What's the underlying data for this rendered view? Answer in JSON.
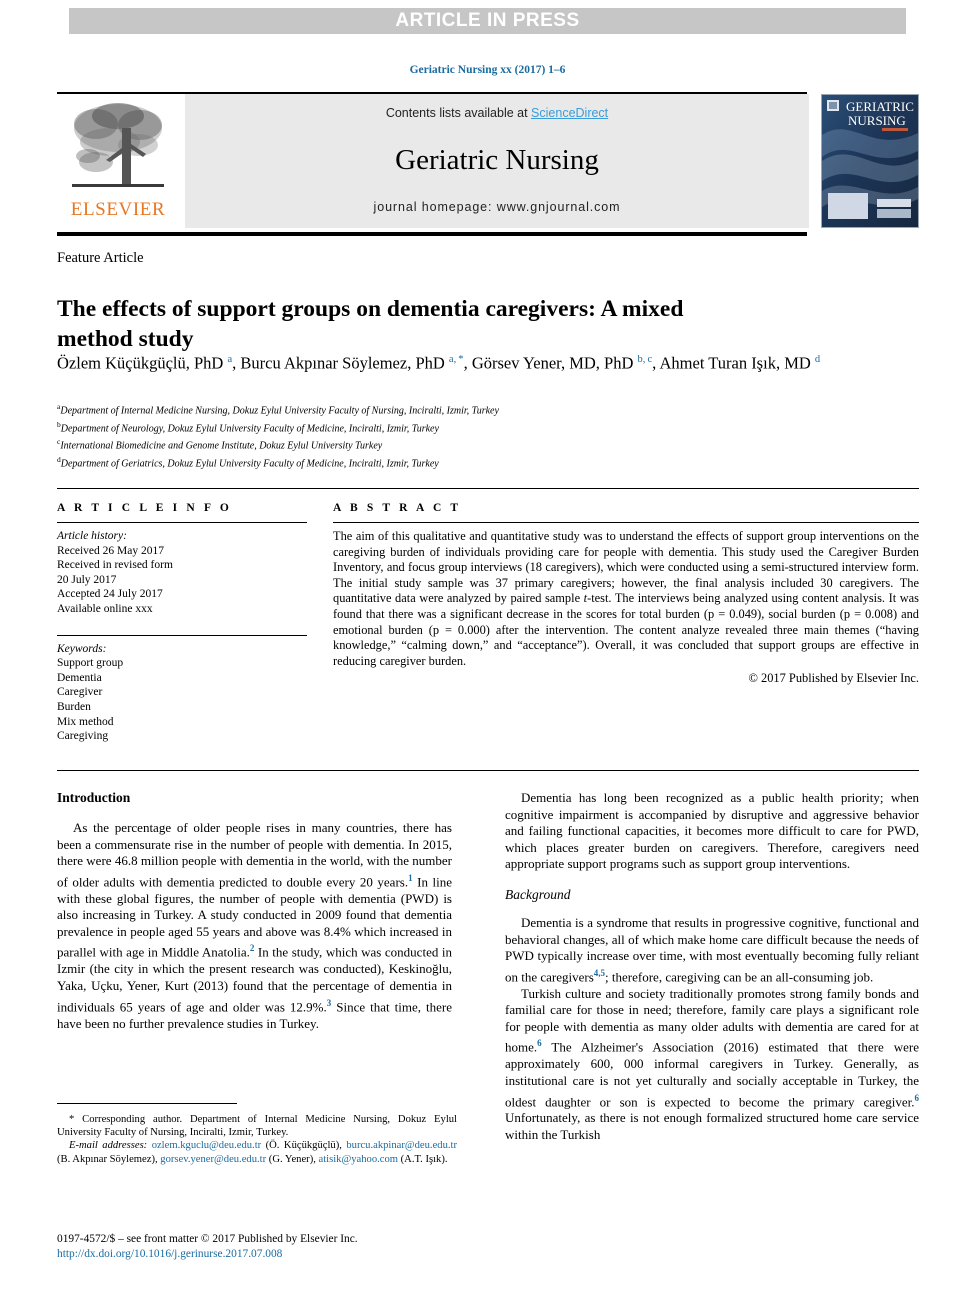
{
  "banner": {
    "text": "ARTICLE IN PRESS"
  },
  "running_head": "Geriatric Nursing xx (2017) 1–6",
  "masthead": {
    "contents_prefix": "Contents lists available at ",
    "sciencedirect": "ScienceDirect",
    "journal_title": "Geriatric Nursing",
    "homepage": "journal homepage: www.gnjournal.com",
    "elsevier_wordmark": "ELSEVIER",
    "cover_line1": "GERIATRIC",
    "cover_line2": "NURSING"
  },
  "article": {
    "type_label": "Feature Article",
    "title": "The effects of support groups on dementia caregivers: A mixed method study",
    "authors_html": "Özlem Küçükgüçlü, PhD <sup>a</sup>, Burcu Akpınar Söylemez, PhD <sup>a, *</sup>, Görsev Yener, MD, PhD <sup>b, c</sup>, Ahmet Turan Işık, MD <sup>d</sup>",
    "affiliations": [
      {
        "marker": "a",
        "text": "Department of Internal Medicine Nursing, Dokuz Eylul University Faculty of Nursing, Inciralti, Izmir, Turkey"
      },
      {
        "marker": "b",
        "text": "Department of Neurology, Dokuz Eylul University Faculty of Medicine, Inciralti, Izmir, Turkey"
      },
      {
        "marker": "c",
        "text": "International Biomedicine and Genome Institute, Dokuz Eylul University Turkey"
      },
      {
        "marker": "d",
        "text": "Department of Geriatrics, Dokuz Eylul University Faculty of Medicine, Inciralti, Izmir, Turkey"
      }
    ]
  },
  "article_info": {
    "heading": "A R T I C L E   I N F O",
    "history_label": "Article history:",
    "history_lines": [
      "Received 26 May 2017",
      "Received in revised form",
      "20 July 2017",
      "Accepted 24 July 2017",
      "Available online xxx"
    ],
    "keywords_label": "Keywords:",
    "keywords": [
      "Support group",
      "Dementia",
      "Caregiver",
      "Burden",
      "Mix method",
      "Caregiving"
    ]
  },
  "abstract": {
    "heading": "A B S T R A C T",
    "body_html": "The aim of this qualitative and quantitative study was to understand the effects of support group interventions on the caregiving burden of individuals providing care for people with dementia. This study used the Caregiver Burden Inventory, and focus group interviews (18 caregivers), which were conducted using a semi-structured interview form. The initial study sample was 37 primary caregivers; however, the final analysis included 30 caregivers. The quantitative data were analyzed by paired sample <i>t</i>-test. The interviews being analyzed using content analysis. It was found that there was a significant decrease in the scores for total burden (p = 0.049), social burden (p = 0.008) and emotional burden (p = 0.000) after the intervention. The content analyze revealed three main themes (“having knowledge,” “calming down,” and “acceptance”). Overall, it was concluded that support groups are effective in reducing caregiver burden.",
    "copyright": "© 2017 Published by Elsevier Inc."
  },
  "body": {
    "left": {
      "heading": "Introduction",
      "paragraph_html": "As the percentage of older people rises in many countries, there has been a commensurate rise in the number of people with dementia. In 2015, there were 46.8 million people with dementia in the world, with the number of older adults with dementia predicted to double every 20 years.<sup>1</sup> In line with these global figures, the number of people with dementia (PWD) is also increasing in Turkey. A study conducted in 2009 found that dementia prevalence in people aged 55 years and above was 8.4% which increased in parallel with age in Middle Anatolia.<sup>2</sup> In the study, which was conducted in Izmir (the city in which the present research was conducted), Keskinoğlu, Yaka, Uçku, Yener, Kurt (2013) found that the percentage of dementia in individuals 65 years of age and older was 12.9%.<sup>3</sup> Since that time, there have been no further prevalence studies in Turkey."
    },
    "right": {
      "paragraph1_html": "Dementia has long been recognized as a public health priority; when cognitive impairment is accompanied by disruptive and aggressive behavior and failing functional capacities, it becomes more difficult to care for PWD, which places greater burden on caregivers. Therefore, caregivers need appropriate support programs such as support group interventions.",
      "subheading": "Background",
      "paragraph2_html": "Dementia is a syndrome that results in progressive cognitive, functional and behavioral changes, all of which make home care difficult because the needs of PWD typically increase over time, with most eventually becoming fully reliant on the caregivers<sup>4,5</sup>; therefore, caregiving can be an all-consuming job.",
      "paragraph3_html": "Turkish culture and society traditionally promotes strong family bonds and familial care for those in need; therefore, family care plays a significant role for people with dementia as many older adults with dementia are cared for at home.<sup>6</sup> The Alzheimer's Association (2016) estimated that there were approximately 600, 000 informal caregivers in Turkey. Generally, as institutional care is not yet culturally and socially acceptable in Turkey, the oldest daughter or son is expected to become the primary caregiver.<sup>6</sup> Unfortunately, as there is not enough formalized structured home care service within the Turkish"
    }
  },
  "footnote": {
    "corresponding_html": "* Corresponding author. Department of Internal Medicine Nursing, Dokuz Eylul University Faculty of Nursing, Inciralti, Izmir, Turkey.",
    "emails_html": "<span class=\"it\">E-mail addresses:</span> <span class=\"lnk\">ozlem.kguclu@deu.edu.tr</span> (Ö. Küçükgüçlü), <span class=\"lnk\">burcu.akpinar@deu.edu.tr</span> (B. Akpınar Söylemez), <span class=\"lnk\">gorsev.yener@deu.edu.tr</span> (G. Yener), <span class=\"lnk\">atisik@yahoo.com</span> (A.T. Işık)."
  },
  "issn": {
    "line1": "0197-4572/$ – see front matter © 2017 Published by Elsevier Inc.",
    "doi": "http://dx.doi.org/10.1016/j.gerinurse.2017.07.008"
  },
  "colors": {
    "banner_bg": "#c6c6c6",
    "link_blue": "#1a6ba0",
    "sciencedirect_blue": "#3c9cd7",
    "elsevier_orange": "#e87722",
    "band_gray": "#e9e9e9"
  }
}
